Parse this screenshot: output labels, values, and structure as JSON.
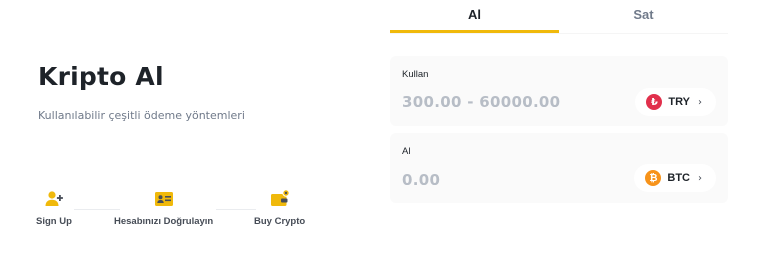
{
  "hero": {
    "title": "Kripto Al",
    "subtitle": "Kullanılabilir çeşitli ödeme yöntemleri"
  },
  "steps": [
    {
      "label": "Sign Up",
      "icon": "user-add-icon"
    },
    {
      "label": "Hesabınızı Doğrulayın",
      "icon": "id-card-icon"
    },
    {
      "label": "Buy Crypto",
      "icon": "wallet-icon"
    }
  ],
  "tabs": [
    {
      "label": "Al",
      "active": true
    },
    {
      "label": "Sat",
      "active": false
    }
  ],
  "spend": {
    "label": "Kullan",
    "placeholder": "300.00 - 60000.00",
    "currency": "TRY",
    "currency_symbol": "₺",
    "currency_color": "#e1304c"
  },
  "receive": {
    "label": "Al",
    "placeholder": "0.00",
    "currency": "BTC",
    "currency_symbol": "₿",
    "currency_color": "#f7931a"
  },
  "colors": {
    "accent": "#f0b90b",
    "text_primary": "#1e2329",
    "text_secondary": "#707a8a",
    "placeholder": "#b7bdc6",
    "field_bg": "#fafafa"
  }
}
